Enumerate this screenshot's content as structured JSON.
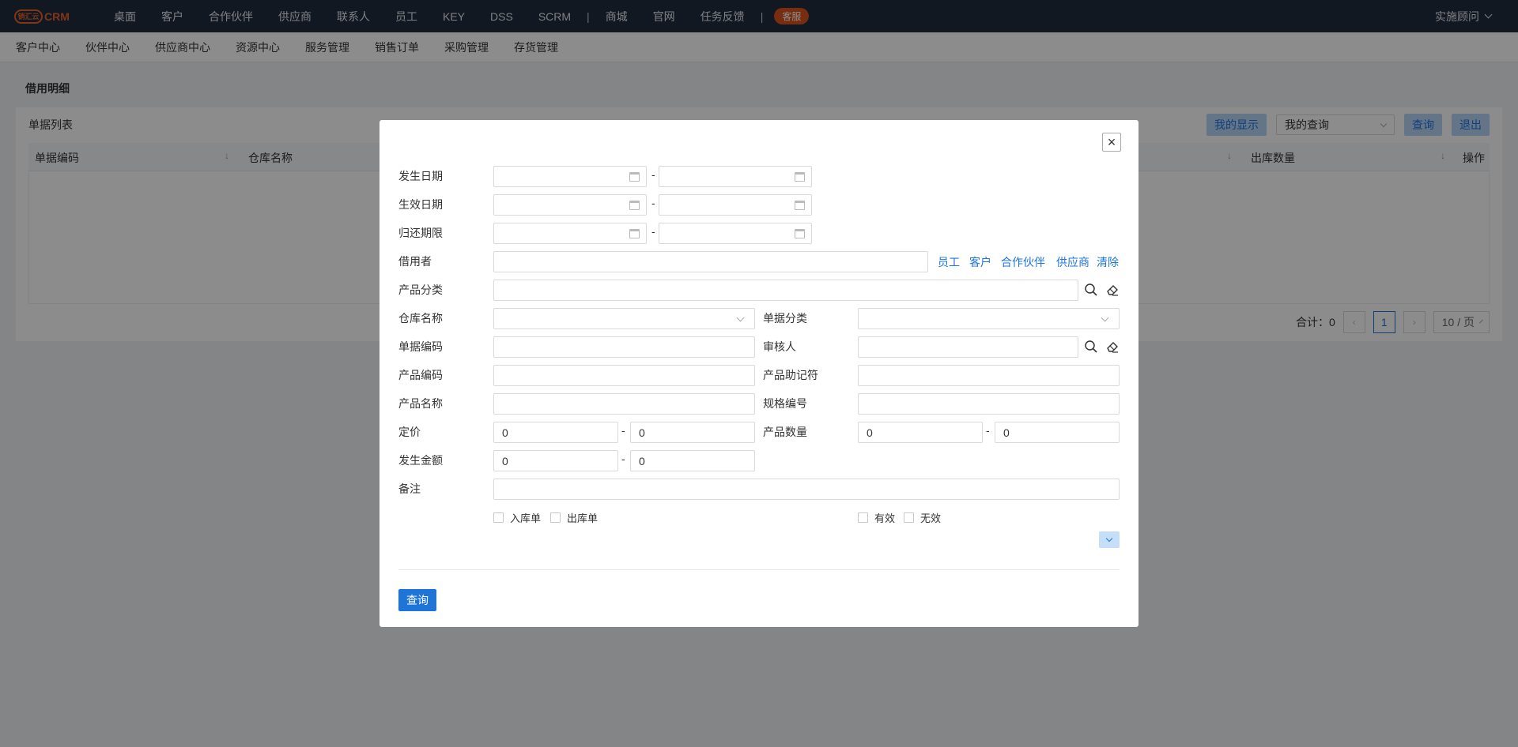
{
  "app": {
    "logo_badge": "销汇云",
    "logo_text": "CRM",
    "user": "实施顾问"
  },
  "topnav": {
    "group1": [
      "桌面",
      "客户",
      "合作伙伴",
      "供应商",
      "联系人",
      "员工",
      "KEY",
      "DSS",
      "SCRM"
    ],
    "group2": [
      "商城",
      "官网",
      "任务反馈"
    ],
    "badge": "客服",
    "separator": "|"
  },
  "subnav": [
    "客户中心",
    "伙伴中心",
    "供应商中心",
    "资源中心",
    "服务管理",
    "销售订单",
    "采购管理",
    "存货管理"
  ],
  "page": {
    "title": "借用明细",
    "list_title": "单据列表",
    "actions": {
      "display": "我的显示",
      "query_select": "我的查询",
      "query": "查询",
      "exit": "退出"
    },
    "columns": [
      "单据编码",
      "仓库名称",
      "出库数量",
      "操作"
    ],
    "pager": {
      "total_label": "合计：",
      "total": "0",
      "page": "1",
      "page_size": "10 / 页",
      "prev": "‹",
      "next": "›"
    }
  },
  "modal": {
    "close": "×",
    "labels": {
      "occur_date": "发生日期",
      "effective_date": "生效日期",
      "return_deadline": "归还期限",
      "borrower": "借用者",
      "product_category": "产品分类",
      "warehouse": "仓库名称",
      "doc_category": "单据分类",
      "doc_code": "单据编码",
      "auditor": "审核人",
      "product_code": "产品编码",
      "product_mnemonic": "产品助记符",
      "product_name": "产品名称",
      "spec_no": "规格编号",
      "price": "定价",
      "product_qty": "产品数量",
      "occur_amount": "发生金额",
      "remark": "备注"
    },
    "range_sep": "-",
    "borrower_links": [
      "员工",
      "客户",
      "合作伙伴",
      "供应商",
      "清除"
    ],
    "values": {
      "price_from": "0",
      "price_to": "0",
      "qty_from": "0",
      "qty_to": "0",
      "amount_from": "0",
      "amount_to": "0"
    },
    "checkboxes": {
      "in_doc": "入库单",
      "out_doc": "出库单",
      "valid": "有效",
      "invalid": "无效"
    },
    "submit": "查询"
  }
}
